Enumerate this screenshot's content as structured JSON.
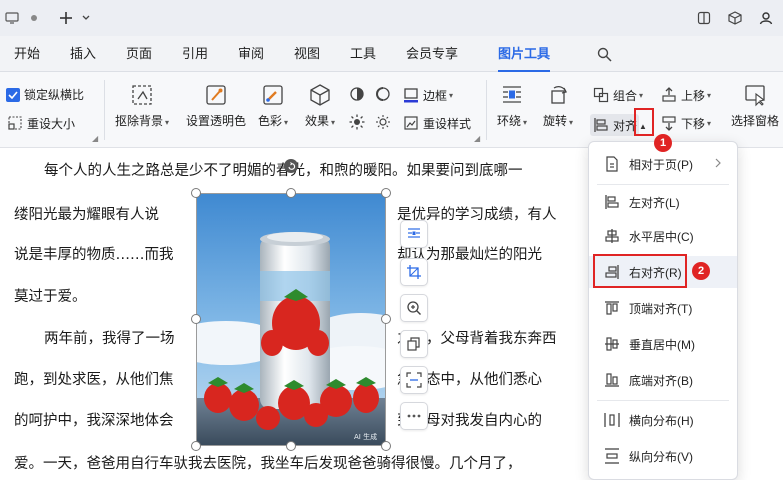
{
  "menu": {
    "tabs": [
      "开始",
      "插入",
      "页面",
      "引用",
      "审阅",
      "视图",
      "工具",
      "会员专享",
      "图片工具"
    ],
    "active_tab": "图片工具"
  },
  "ribbon": {
    "lock_ratio": "锁定纵横比",
    "lock_ratio_checked": true,
    "reset_size": "重设大小",
    "remove_bg": "抠除背景",
    "set_transparent": "设置透明色",
    "color": "色彩",
    "effects": "效果",
    "border": "边框",
    "reset_style": "重设样式",
    "wrap": "环绕",
    "rotate": "旋转",
    "align": "对齐",
    "group": "组合",
    "bring_forward": "上移",
    "send_backward": "下移",
    "selection_pane": "选择窗格"
  },
  "document": {
    "lines": [
      "每个人的人生之路总是少不了明媚的春光，和煦的暖阳。如果要问到底哪一",
      "缕阳光最为耀眼有人说",
      "是优异的学习成绩，有人",
      "说是丰厚的物质……而我",
      "却认为那最灿烂的阳光",
      "莫过于爱。",
      "两年前，我得了一场",
      "之后，父母背着我东奔西",
      "跑，到处求医，从他们焦",
      "急神态中，从他们悉心",
      "的呵护中，我深深地体会",
      "到父母对我发自内心的",
      "爱。一天，爸爸用自行车驮我去医院，我坐车后发现爸爸骑得很慢。几个月了，"
    ],
    "image_watermark": "AI 生成"
  },
  "align_menu": {
    "items": [
      {
        "label": "相对于页(P)",
        "icon": "page-relative-icon",
        "submenu": true
      },
      {
        "label": "左对齐(L)",
        "icon": "align-left-icon"
      },
      {
        "label": "水平居中(C)",
        "icon": "align-center-h-icon"
      },
      {
        "label": "右对齐(R)",
        "icon": "align-right-icon",
        "highlighted": true
      },
      {
        "label": "顶端对齐(T)",
        "icon": "align-top-icon"
      },
      {
        "label": "垂直居中(M)",
        "icon": "align-middle-v-icon"
      },
      {
        "label": "底端对齐(B)",
        "icon": "align-bottom-icon"
      },
      {
        "label": "横向分布(H)",
        "icon": "distribute-h-icon"
      },
      {
        "label": "纵向分布(V)",
        "icon": "distribute-v-icon"
      }
    ]
  },
  "annotations": {
    "step1": "1",
    "step2": "2"
  },
  "colors": {
    "accent": "#2b6ae6",
    "annotation_red": "#e02424"
  }
}
